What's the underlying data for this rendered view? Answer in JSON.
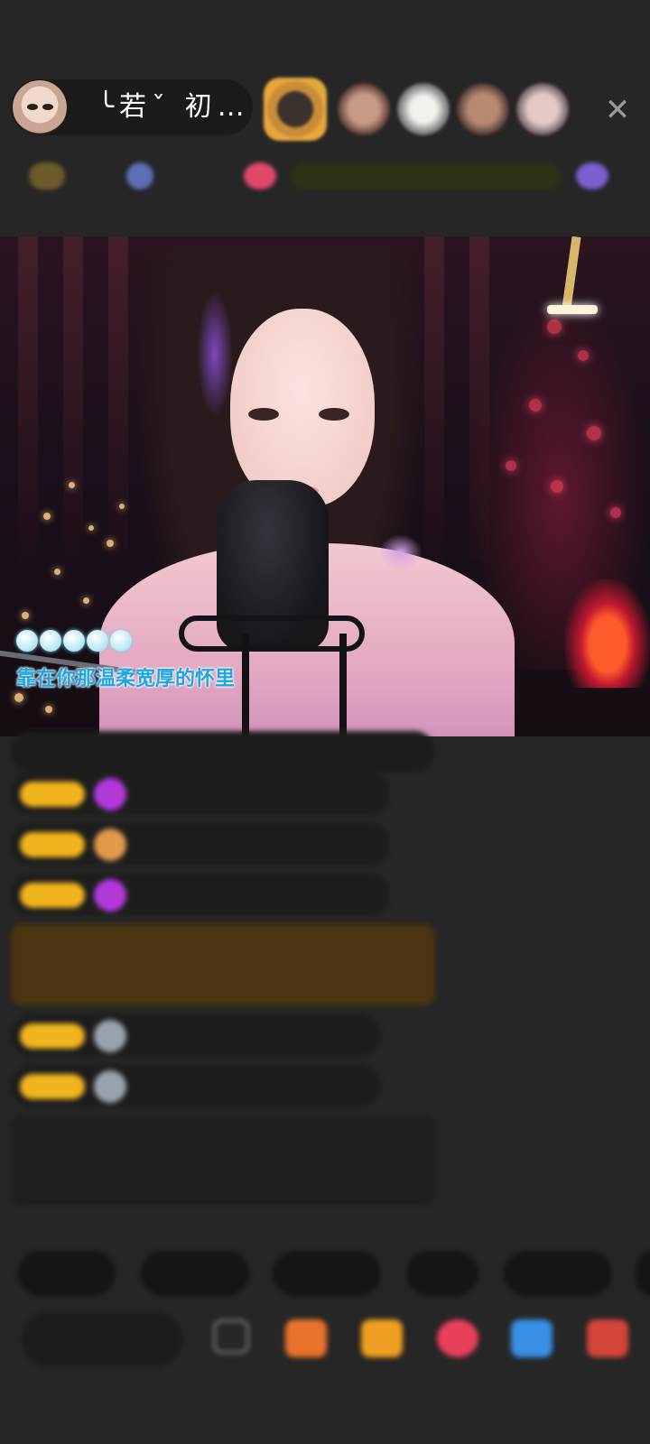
{
  "header": {
    "host_name": "╰若ˇ 初…",
    "close_icon": "✕"
  },
  "rank_bar": {
    "items": [
      "",
      "",
      "",
      "",
      "",
      "",
      ""
    ]
  },
  "video": {
    "lyric_text": "靠在你那温柔宽厚的怀里",
    "lyric_dot_count": 5
  },
  "chat": {
    "messages": [
      {
        "name": "",
        "content": ""
      },
      {
        "name": "",
        "content": ""
      },
      {
        "name": "",
        "content": ""
      },
      {
        "name": "",
        "content": ""
      },
      {
        "name": "",
        "content": ""
      },
      {
        "name": "",
        "content": ""
      },
      {
        "name": "",
        "content": ""
      },
      {
        "name": "",
        "content": ""
      }
    ]
  },
  "quick_chips": [
    "",
    "",
    "",
    "",
    ""
  ],
  "bottom_bar": {
    "input_placeholder": ""
  },
  "colors": {
    "background": "#262626",
    "level_badge": "#f1b41c",
    "lyric": "#1ea5e6",
    "chat_green": "#9fd16a"
  }
}
